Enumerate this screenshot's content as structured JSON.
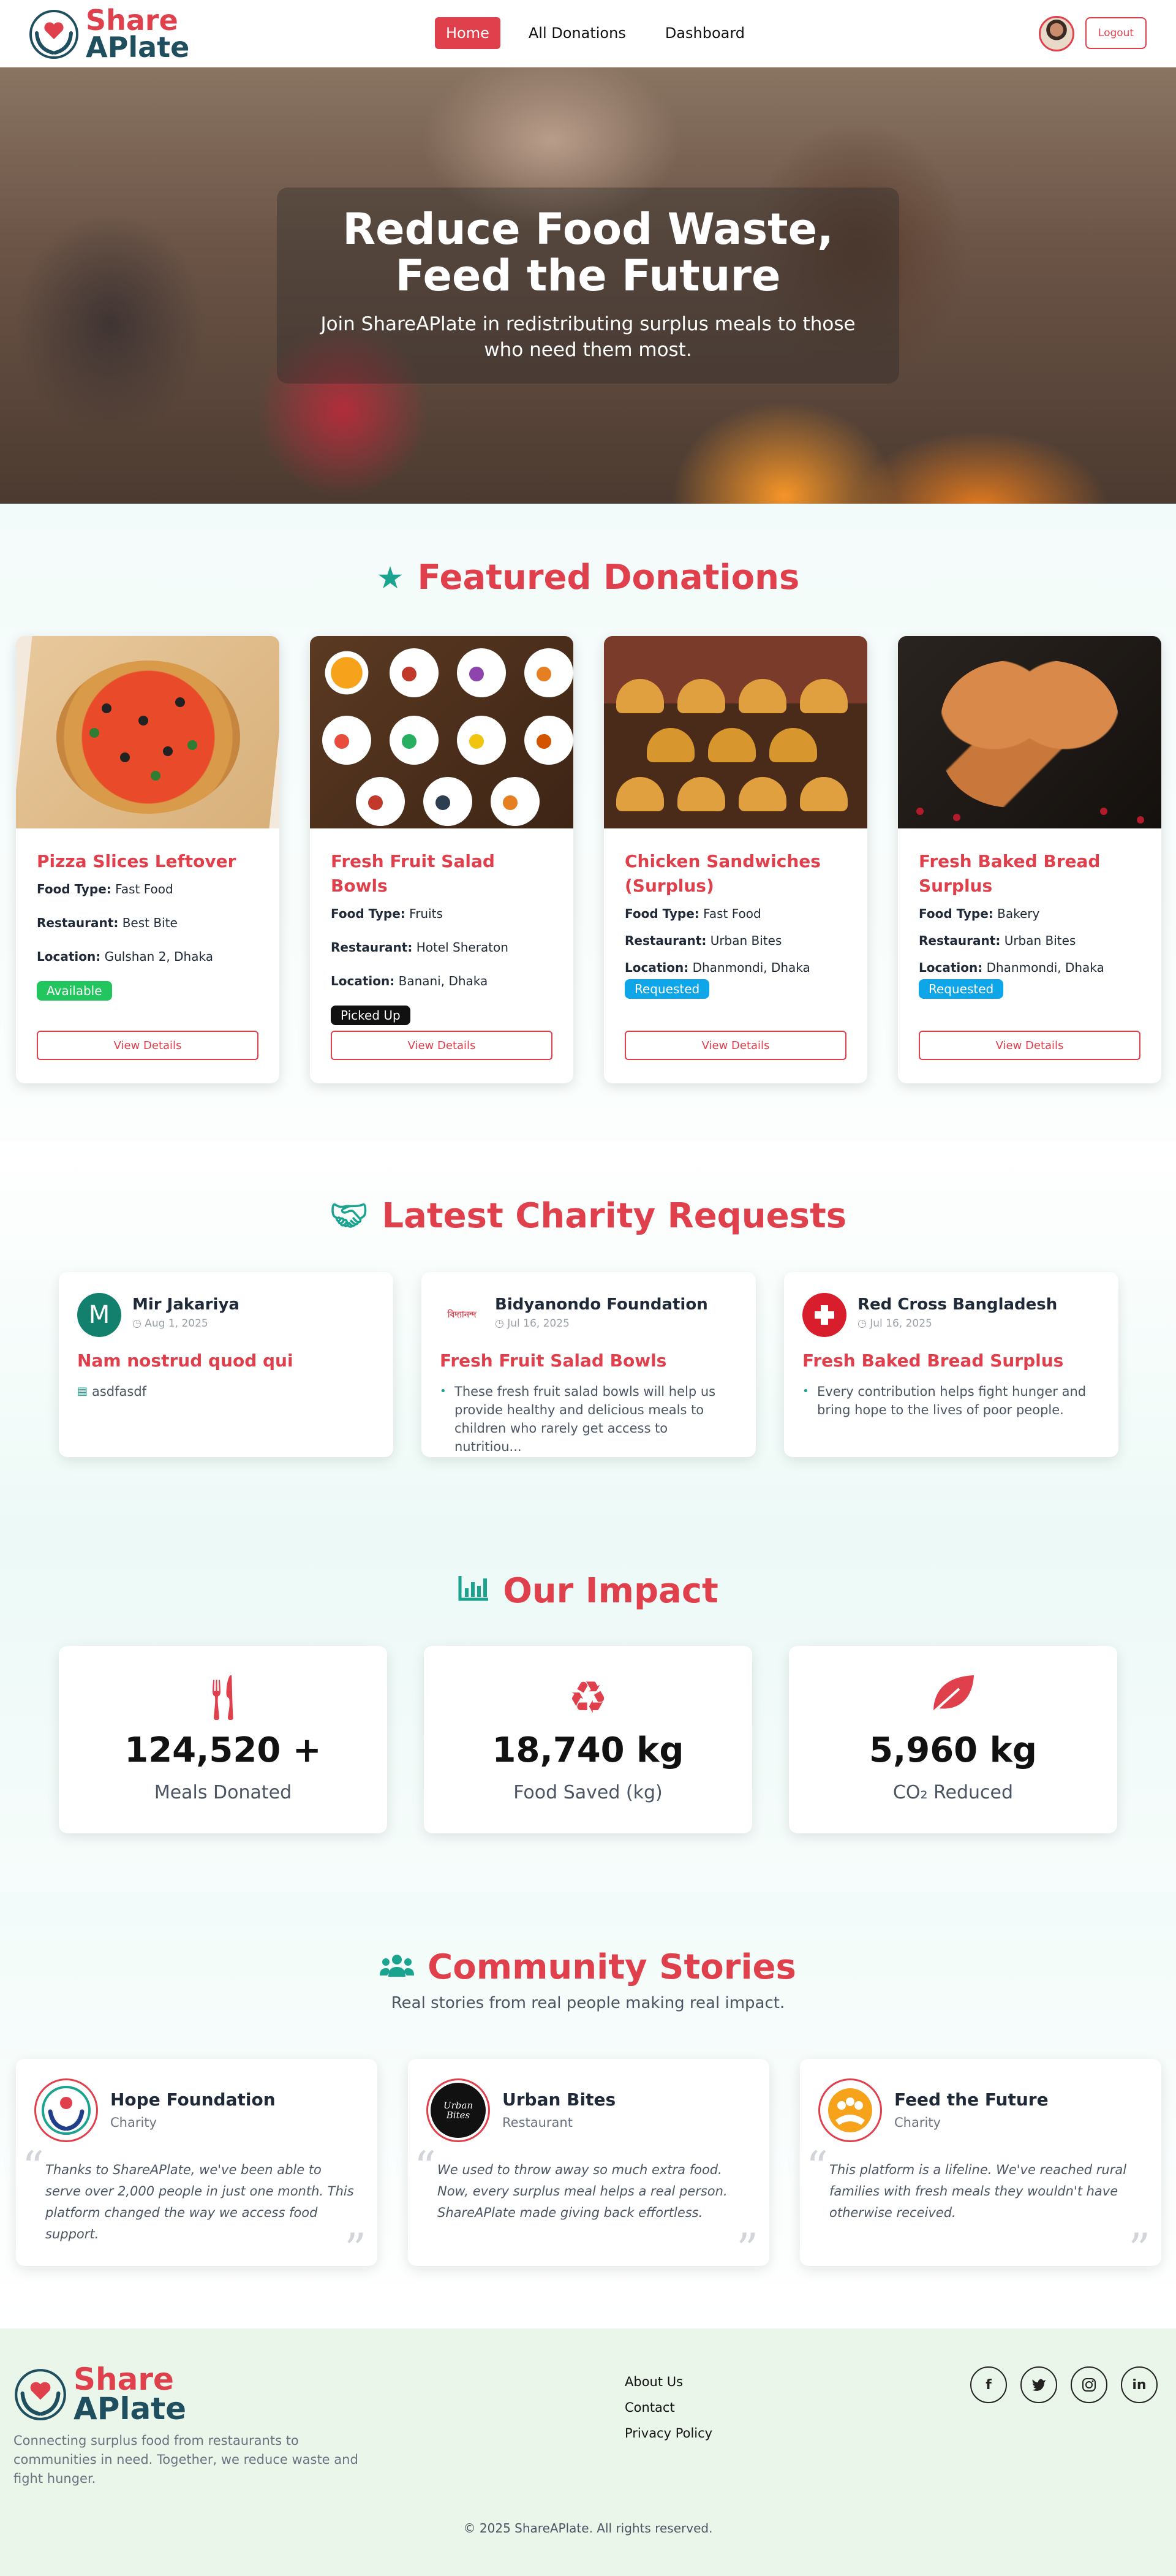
{
  "brand": {
    "line1": "Share",
    "line2": "APlate",
    "accent": "#e0404c",
    "dark": "#1f4e5f",
    "teal": "#1aa38f"
  },
  "nav": {
    "links": [
      {
        "label": "Home",
        "active": true
      },
      {
        "label": "All Donations",
        "active": false
      },
      {
        "label": "Dashboard",
        "active": false
      }
    ],
    "logout_label": "Logout"
  },
  "hero": {
    "title_line1": "Reduce Food Waste,",
    "title_line2": "Feed the Future",
    "subtitle": "Join ShareAPlate in redistributing surplus meals to those who need them most."
  },
  "featured": {
    "heading": "Featured Donations",
    "icon": "star-icon",
    "labels": {
      "food_type": "Food Type:",
      "restaurant": "Restaurant:",
      "location": "Location:"
    },
    "cards": [
      {
        "title": "Pizza Slices Leftover",
        "food_type": "Fast Food",
        "restaurant": "Best Bite",
        "location": "Gulshan 2, Dhaka",
        "status": "Available",
        "button": "View Details"
      },
      {
        "title": "Fresh Fruit Salad Bowls",
        "food_type": "Fruits",
        "restaurant": "Hotel Sheraton",
        "location": "Banani, Dhaka",
        "status": "Picked Up",
        "button": "View Details"
      },
      {
        "title": "Chicken Sandwiches (Surplus)",
        "food_type": "Fast Food",
        "restaurant": "Urban Bites",
        "location": "Dhanmondi, Dhaka",
        "status": "Requested",
        "button": "View Details"
      },
      {
        "title": "Fresh Baked Bread Surplus",
        "food_type": "Bakery",
        "restaurant": "Urban Bites",
        "location": "Dhanmondi, Dhaka",
        "status": "Requested",
        "button": "View Details"
      }
    ]
  },
  "charity": {
    "heading": "Latest Charity Requests",
    "icon": "handshake-icon",
    "requests": [
      {
        "avatar_letter": "M",
        "name": "Mir Jakariya",
        "date": "Aug 1, 2025",
        "title": "Nam nostrud quod qui",
        "description": "asdfasdf"
      },
      {
        "avatar_letter": "",
        "logo_text": "বিদ্যানন্দ",
        "name": "Bidyanondo Foundation",
        "date": "Jul 16, 2025",
        "title": "Fresh Fruit Salad Bowls",
        "description": "These fresh fruit salad bowls will help us provide healthy and delicious meals to children who rarely get access to nutritiou..."
      },
      {
        "avatar_letter": "",
        "name": "Red Cross Bangladesh",
        "date": "Jul 16, 2025",
        "title": "Fresh Baked Bread Surplus",
        "description": "Every contribution helps fight hunger and bring hope to the lives of poor people."
      }
    ]
  },
  "impact": {
    "heading": "Our Impact",
    "icon": "chart-bar-icon",
    "stats": [
      {
        "icon": "utensils-icon",
        "value": "124,520 +",
        "label": "Meals Donated"
      },
      {
        "icon": "recycle-icon",
        "value": "18,740 kg",
        "label": "Food Saved (kg)"
      },
      {
        "icon": "leaf-icon",
        "value": "5,960 kg",
        "label": "CO₂ Reduced"
      }
    ]
  },
  "stories": {
    "heading": "Community Stories",
    "subtitle": "Real stories from real people making real impact.",
    "icon": "users-icon",
    "items": [
      {
        "name": "Hope Foundation",
        "type": "Charity",
        "text": "Thanks to ShareAPlate, we've been able to serve over 2,000 people in just one month. This platform changed the way we access food support."
      },
      {
        "name": "Urban Bites",
        "type": "Restaurant",
        "logo_text": "Urban Bites",
        "text": "We used to throw away so much extra food. Now, every surplus meal helps a real person. ShareAPlate made giving back effortless."
      },
      {
        "name": "Feed the Future",
        "type": "Charity",
        "text": "This platform is a lifeline. We've reached rural families with fresh meals they wouldn't have otherwise received."
      }
    ]
  },
  "footer": {
    "description": "Connecting surplus food from restaurants to communities in need. Together, we reduce waste and fight hunger.",
    "links": [
      "About Us",
      "Contact",
      "Privacy Policy"
    ],
    "socials": [
      {
        "icon": "facebook-icon",
        "glyph": "f"
      },
      {
        "icon": "twitter-icon",
        "glyph": "t"
      },
      {
        "icon": "instagram-icon",
        "glyph": "◎"
      },
      {
        "icon": "linkedin-icon",
        "glyph": "in"
      }
    ],
    "copyright": "© 2025 ShareAPlate. All rights reserved."
  }
}
